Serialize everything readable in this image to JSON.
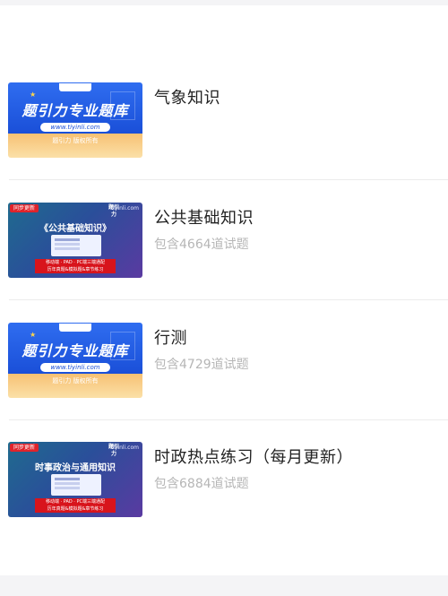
{
  "items": [
    {
      "title": "气象知识",
      "count": "",
      "thumb": {
        "headline": "题引力专业题库",
        "url": "www.tiyinli.com",
        "footer": "题引力 版权所有",
        "logo": "题引力"
      }
    },
    {
      "title": "公共基础知识",
      "count": "包含4664道试题",
      "thumb": {
        "badge": "同步更新",
        "url": "tiyinli.com",
        "brand": "题引力",
        "headline": "《公共基础知识》",
        "red_line1": "移动端 · PAD · PC端三端通配",
        "red_line2": "历年真题&模拟题&章节练习"
      }
    },
    {
      "title": "行测",
      "count": "包含4729道试题",
      "thumb": {
        "headline": "题引力专业题库",
        "url": "www.tiyinli.com",
        "footer": "题引力 版权所有",
        "logo": "题引力"
      }
    },
    {
      "title": "时政热点练习（每月更新）",
      "count": "包含6884道试题",
      "thumb": {
        "badge": "同步更新",
        "url": "tiyinli.com",
        "brand": "题引力",
        "headline": "时事政治与通用知识",
        "red_line1": "移动端 · PAD · PC端三端通配",
        "red_line2": "历年真题&模拟题&章节练习"
      }
    }
  ],
  "colors": {
    "accent_blue": "#1a4fd8",
    "accent_purple": "#5a3aa1",
    "badge_red": "#e0242b"
  }
}
